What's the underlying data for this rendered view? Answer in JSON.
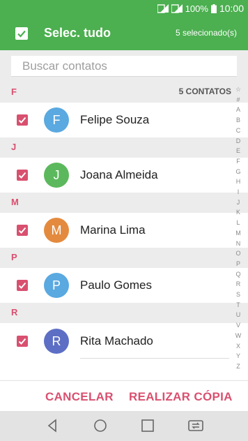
{
  "status_bar": {
    "battery_text": "100%",
    "time": "10:00",
    "icons": [
      "sim1-signal-icon",
      "sim2-signal-icon",
      "battery-icon"
    ]
  },
  "app_bar": {
    "title": "Selec. tudo",
    "selected_count": "5 selecionado(s)",
    "select_all_checked": true
  },
  "search": {
    "placeholder": "Buscar contatos"
  },
  "contacts_total": "5 CONTATOS",
  "sections": [
    {
      "letter": "F",
      "contacts": [
        {
          "name": "Felipe Souza",
          "initial": "F",
          "avatar_color": "#5aa9e0",
          "checked": true
        }
      ]
    },
    {
      "letter": "J",
      "contacts": [
        {
          "name": "Joana Almeida",
          "initial": "J",
          "avatar_color": "#5cb85c",
          "checked": true
        }
      ]
    },
    {
      "letter": "M",
      "contacts": [
        {
          "name": "Marina Lima",
          "initial": "M",
          "avatar_color": "#e48a3e",
          "checked": true
        }
      ]
    },
    {
      "letter": "P",
      "contacts": [
        {
          "name": "Paulo Gomes",
          "initial": "P",
          "avatar_color": "#5aa9e0",
          "checked": true
        }
      ]
    },
    {
      "letter": "R",
      "contacts": [
        {
          "name": "Rita Machado",
          "initial": "R",
          "avatar_color": "#5d6fc4",
          "checked": true
        }
      ]
    }
  ],
  "index_bar": [
    "☆",
    "#",
    "A",
    "B",
    "C",
    "D",
    "E",
    "F",
    "G",
    "H",
    "I",
    "J",
    "K",
    "L",
    "M",
    "N",
    "O",
    "P",
    "Q",
    "R",
    "S",
    "T",
    "U",
    "V",
    "W",
    "X",
    "Y",
    "Z"
  ],
  "footer": {
    "cancel_label": "CANCELAR",
    "copy_label": "REALIZAR CÓPIA"
  },
  "nav_bar": {
    "icons": [
      "back-icon",
      "home-icon",
      "recents-icon",
      "switch-sim-icon"
    ]
  },
  "colors": {
    "primary": "#4caf50",
    "accent": "#d9506f"
  }
}
